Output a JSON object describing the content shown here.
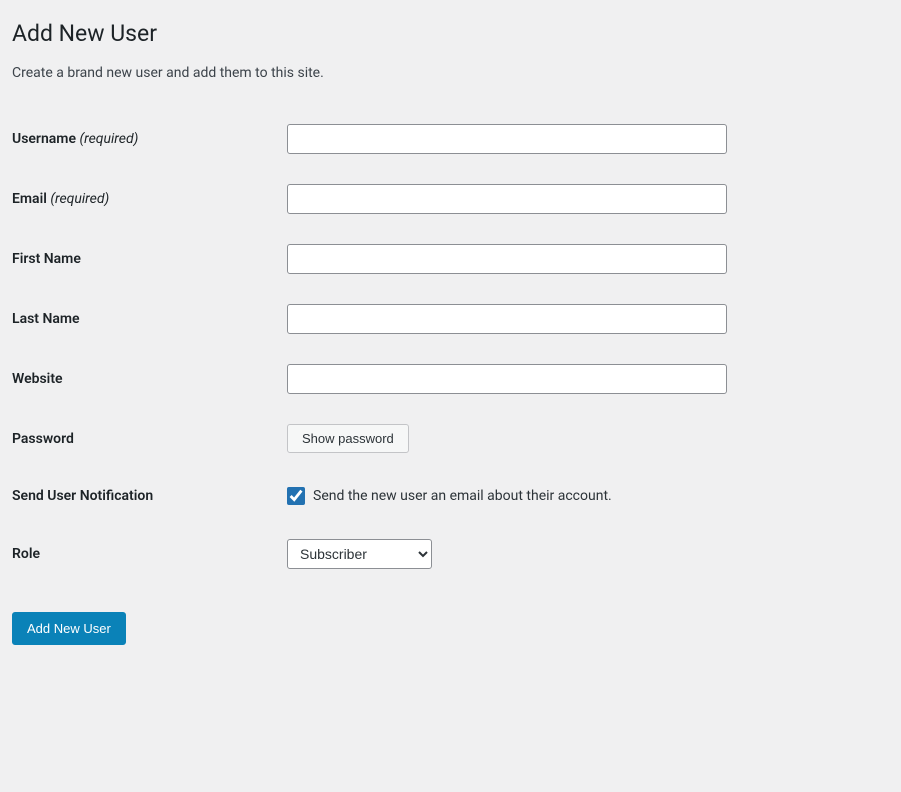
{
  "header": {
    "title": "Add New User",
    "description": "Create a brand new user and add them to this site."
  },
  "fields": {
    "username": {
      "label": "Username",
      "required_text": "(required)",
      "value": ""
    },
    "email": {
      "label": "Email",
      "required_text": "(required)",
      "value": ""
    },
    "first_name": {
      "label": "First Name",
      "value": ""
    },
    "last_name": {
      "label": "Last Name",
      "value": ""
    },
    "website": {
      "label": "Website",
      "value": ""
    },
    "password": {
      "label": "Password",
      "button_label": "Show password"
    },
    "send_notification": {
      "label": "Send User Notification",
      "checkbox_label": "Send the new user an email about their account.",
      "checked": true
    },
    "role": {
      "label": "Role",
      "selected": "Subscriber"
    }
  },
  "submit": {
    "label": "Add New User"
  }
}
